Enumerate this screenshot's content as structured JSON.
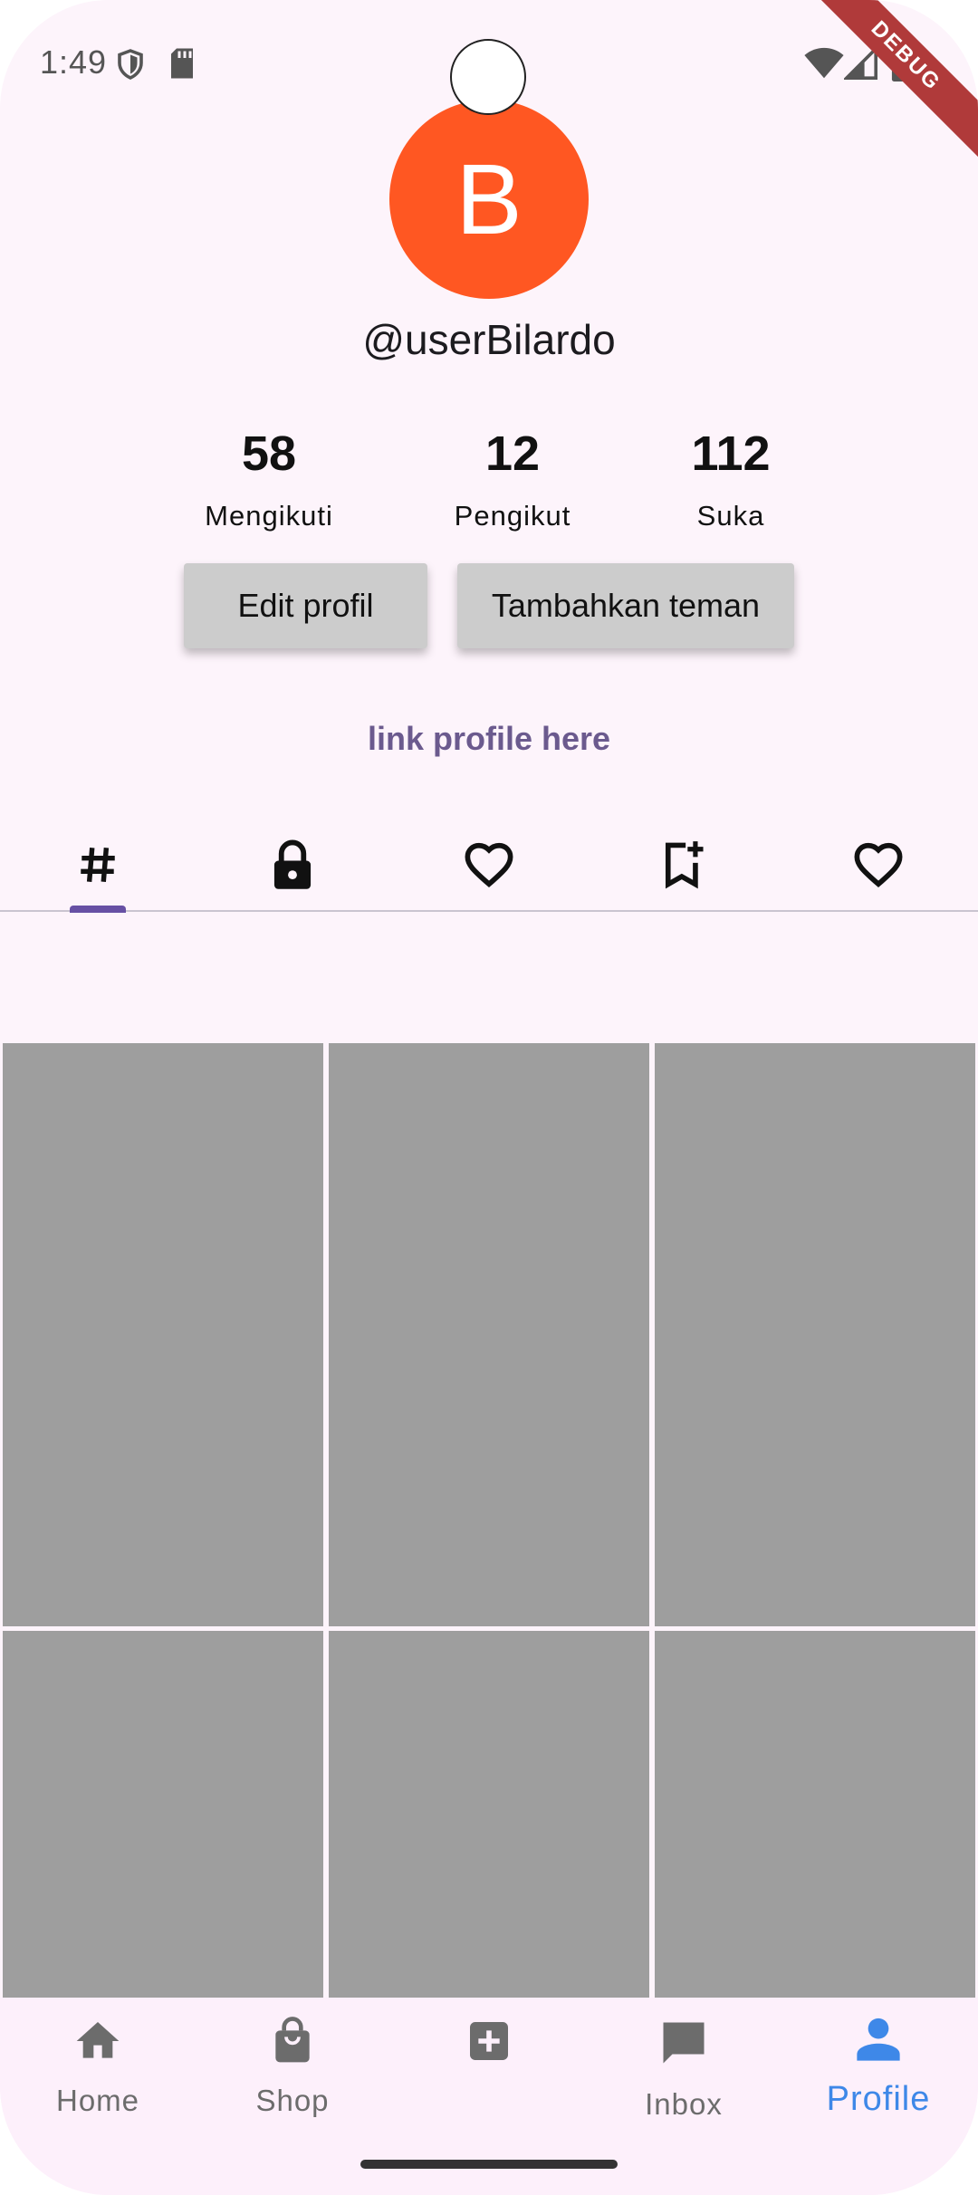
{
  "status_bar": {
    "time": "1:49",
    "debug_label": "DEBUG"
  },
  "profile": {
    "avatar_initial": "B",
    "username": "@userBilardo",
    "stats": [
      {
        "value": "58",
        "label": "Mengikuti"
      },
      {
        "value": "12",
        "label": "Pengikut"
      },
      {
        "value": "112",
        "label": "Suka"
      }
    ],
    "edit_button": "Edit profil",
    "add_friend_button": "Tambahkan teman",
    "link_text": "link profile here"
  },
  "tabs": [
    {
      "icon": "hashtag-icon",
      "selected": true
    },
    {
      "icon": "lock-icon",
      "selected": false
    },
    {
      "icon": "heart-outline-icon",
      "selected": false
    },
    {
      "icon": "bookmark-add-icon",
      "selected": false
    },
    {
      "icon": "heart-outline-icon",
      "selected": false
    }
  ],
  "bottom_nav": [
    {
      "label": "Home",
      "icon": "home-icon",
      "active": false
    },
    {
      "label": "Shop",
      "icon": "shopping-bag-icon",
      "active": false
    },
    {
      "label": "",
      "icon": "add-box-icon",
      "active": false
    },
    {
      "label": "Inbox",
      "icon": "chat-icon",
      "active": false
    },
    {
      "label": "Profile",
      "icon": "person-icon",
      "active": true
    }
  ],
  "colors": {
    "avatar": "#ff5722",
    "accent": "#6750a4",
    "active_nav": "#3e88e8",
    "thumbnail": "#9e9e9e"
  }
}
